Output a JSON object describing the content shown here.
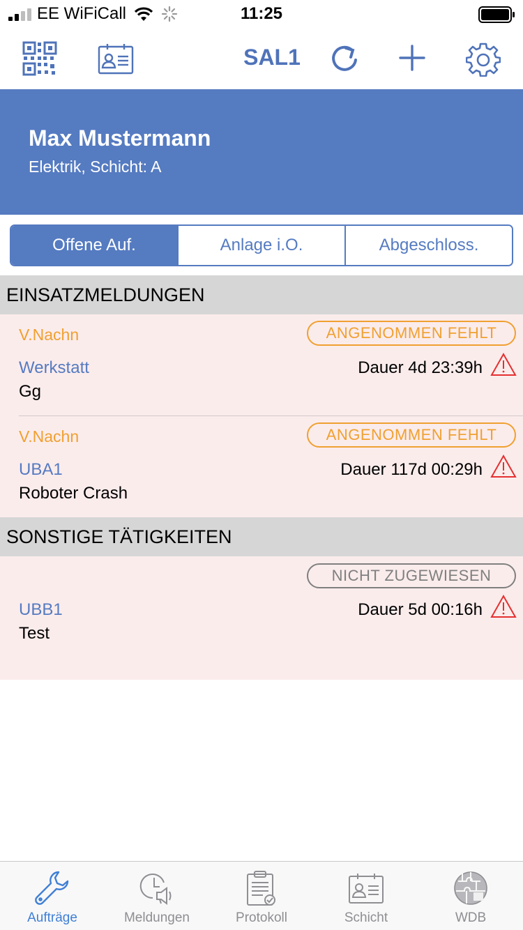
{
  "status_bar": {
    "carrier": "EE WiFiCall",
    "time": "11:25",
    "icons": [
      "signal-icon",
      "wifi-icon",
      "activity-spinner-icon",
      "battery-icon"
    ]
  },
  "navbar": {
    "title": "SAL1",
    "left_icons": [
      "qr-code-icon",
      "id-card-icon"
    ],
    "right_icons": [
      "refresh-icon",
      "plus-icon",
      "gear-icon"
    ],
    "accent_color": "#4f73b9"
  },
  "header": {
    "name": "Max Mustermann",
    "subtitle": "Elektrik, Schicht: A",
    "background": "#557bc1"
  },
  "segment": {
    "items": [
      "Offene Auf.",
      "Anlage i.O.",
      "Abgeschloss."
    ],
    "selected": "Offene Auf."
  },
  "sections": [
    {
      "title": "EINSATZMELDUNGEN",
      "items": [
        {
          "reporter": "V.Nachn",
          "status": "ANGENOMMEN FEHLT",
          "station": "Werkstatt",
          "duration": "Dauer 4d 23:39h",
          "description": "Gg"
        },
        {
          "reporter": "V.Nachn",
          "status": "ANGENOMMEN FEHLT",
          "station": "UBA1",
          "duration": "Dauer 117d 00:29h",
          "description": "Roboter Crash"
        }
      ]
    },
    {
      "title": "SONSTIGE TÄTIGKEITEN",
      "items": [
        {
          "reporter": "",
          "status": "NICHT ZUGEWIESEN",
          "station": "UBB1",
          "duration": "Dauer 5d 00:16h",
          "description": "Test"
        }
      ]
    }
  ],
  "colors": {
    "status_orange": "#f0a030",
    "status_gray": "#7f7f7f",
    "warning_red": "#e53030",
    "card_background": "#fbecec",
    "section_header_background": "#d6d6d6"
  },
  "tabbar": {
    "tabs": [
      {
        "label": "Aufträge",
        "icon": "wrench-icon",
        "active": true
      },
      {
        "label": "Meldungen",
        "icon": "clock-megaphone-icon",
        "active": false
      },
      {
        "label": "Protokoll",
        "icon": "clipboard-icon",
        "active": false
      },
      {
        "label": "Schicht",
        "icon": "id-badge-icon",
        "active": false
      },
      {
        "label": "WDB",
        "icon": "puzzle-globe-icon",
        "active": false
      }
    ]
  }
}
